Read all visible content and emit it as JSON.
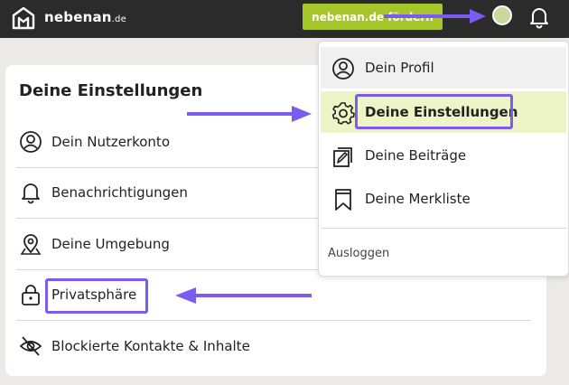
{
  "header": {
    "logo_name": "nebenan",
    "logo_tld": ".de",
    "promo_button": "nebenan.de fördern"
  },
  "settings_card": {
    "title": "Deine Einstellungen",
    "items": [
      {
        "label": "Dein Nutzerkonto",
        "icon": "user-circle-icon"
      },
      {
        "label": "Benachrichtigungen",
        "icon": "bell-icon"
      },
      {
        "label": "Deine Umgebung",
        "icon": "map-pin-icon"
      },
      {
        "label": "Privatsphäre",
        "icon": "lock-icon"
      },
      {
        "label": "Blockierte Kontakte & Inhalte",
        "icon": "eye-slash-icon"
      }
    ]
  },
  "user_menu": {
    "items": [
      {
        "label": "Dein Profil",
        "icon": "user-circle-icon"
      },
      {
        "label": "Deine Einstellungen",
        "icon": "gear-icon"
      },
      {
        "label": "Deine Beiträge",
        "icon": "edit-posts-icon"
      },
      {
        "label": "Deine Merkliste",
        "icon": "bookmark-icon"
      }
    ],
    "logout": "Ausloggen"
  },
  "colors": {
    "topbar": "#2b2b2b",
    "promo": "#a6c72a",
    "annotation": "#7b5cf0",
    "active_item": "#edf5c6"
  }
}
